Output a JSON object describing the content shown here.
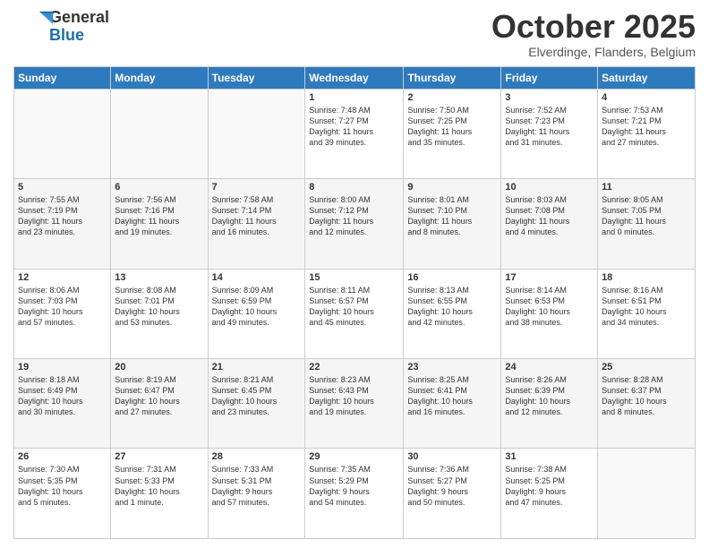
{
  "header": {
    "logo_general": "General",
    "logo_blue": "Blue",
    "month": "October 2025",
    "location": "Elverdinge, Flanders, Belgium"
  },
  "days_of_week": [
    "Sunday",
    "Monday",
    "Tuesday",
    "Wednesday",
    "Thursday",
    "Friday",
    "Saturday"
  ],
  "weeks": [
    [
      {
        "day": "",
        "info": ""
      },
      {
        "day": "",
        "info": ""
      },
      {
        "day": "",
        "info": ""
      },
      {
        "day": "1",
        "info": "Sunrise: 7:48 AM\nSunset: 7:27 PM\nDaylight: 11 hours\nand 39 minutes."
      },
      {
        "day": "2",
        "info": "Sunrise: 7:50 AM\nSunset: 7:25 PM\nDaylight: 11 hours\nand 35 minutes."
      },
      {
        "day": "3",
        "info": "Sunrise: 7:52 AM\nSunset: 7:23 PM\nDaylight: 11 hours\nand 31 minutes."
      },
      {
        "day": "4",
        "info": "Sunrise: 7:53 AM\nSunset: 7:21 PM\nDaylight: 11 hours\nand 27 minutes."
      }
    ],
    [
      {
        "day": "5",
        "info": "Sunrise: 7:55 AM\nSunset: 7:19 PM\nDaylight: 11 hours\nand 23 minutes."
      },
      {
        "day": "6",
        "info": "Sunrise: 7:56 AM\nSunset: 7:16 PM\nDaylight: 11 hours\nand 19 minutes."
      },
      {
        "day": "7",
        "info": "Sunrise: 7:58 AM\nSunset: 7:14 PM\nDaylight: 11 hours\nand 16 minutes."
      },
      {
        "day": "8",
        "info": "Sunrise: 8:00 AM\nSunset: 7:12 PM\nDaylight: 11 hours\nand 12 minutes."
      },
      {
        "day": "9",
        "info": "Sunrise: 8:01 AM\nSunset: 7:10 PM\nDaylight: 11 hours\nand 8 minutes."
      },
      {
        "day": "10",
        "info": "Sunrise: 8:03 AM\nSunset: 7:08 PM\nDaylight: 11 hours\nand 4 minutes."
      },
      {
        "day": "11",
        "info": "Sunrise: 8:05 AM\nSunset: 7:05 PM\nDaylight: 11 hours\nand 0 minutes."
      }
    ],
    [
      {
        "day": "12",
        "info": "Sunrise: 8:06 AM\nSunset: 7:03 PM\nDaylight: 10 hours\nand 57 minutes."
      },
      {
        "day": "13",
        "info": "Sunrise: 8:08 AM\nSunset: 7:01 PM\nDaylight: 10 hours\nand 53 minutes."
      },
      {
        "day": "14",
        "info": "Sunrise: 8:09 AM\nSunset: 6:59 PM\nDaylight: 10 hours\nand 49 minutes."
      },
      {
        "day": "15",
        "info": "Sunrise: 8:11 AM\nSunset: 6:57 PM\nDaylight: 10 hours\nand 45 minutes."
      },
      {
        "day": "16",
        "info": "Sunrise: 8:13 AM\nSunset: 6:55 PM\nDaylight: 10 hours\nand 42 minutes."
      },
      {
        "day": "17",
        "info": "Sunrise: 8:14 AM\nSunset: 6:53 PM\nDaylight: 10 hours\nand 38 minutes."
      },
      {
        "day": "18",
        "info": "Sunrise: 8:16 AM\nSunset: 6:51 PM\nDaylight: 10 hours\nand 34 minutes."
      }
    ],
    [
      {
        "day": "19",
        "info": "Sunrise: 8:18 AM\nSunset: 6:49 PM\nDaylight: 10 hours\nand 30 minutes."
      },
      {
        "day": "20",
        "info": "Sunrise: 8:19 AM\nSunset: 6:47 PM\nDaylight: 10 hours\nand 27 minutes."
      },
      {
        "day": "21",
        "info": "Sunrise: 8:21 AM\nSunset: 6:45 PM\nDaylight: 10 hours\nand 23 minutes."
      },
      {
        "day": "22",
        "info": "Sunrise: 8:23 AM\nSunset: 6:43 PM\nDaylight: 10 hours\nand 19 minutes."
      },
      {
        "day": "23",
        "info": "Sunrise: 8:25 AM\nSunset: 6:41 PM\nDaylight: 10 hours\nand 16 minutes."
      },
      {
        "day": "24",
        "info": "Sunrise: 8:26 AM\nSunset: 6:39 PM\nDaylight: 10 hours\nand 12 minutes."
      },
      {
        "day": "25",
        "info": "Sunrise: 8:28 AM\nSunset: 6:37 PM\nDaylight: 10 hours\nand 8 minutes."
      }
    ],
    [
      {
        "day": "26",
        "info": "Sunrise: 7:30 AM\nSunset: 5:35 PM\nDaylight: 10 hours\nand 5 minutes."
      },
      {
        "day": "27",
        "info": "Sunrise: 7:31 AM\nSunset: 5:33 PM\nDaylight: 10 hours\nand 1 minute."
      },
      {
        "day": "28",
        "info": "Sunrise: 7:33 AM\nSunset: 5:31 PM\nDaylight: 9 hours\nand 57 minutes."
      },
      {
        "day": "29",
        "info": "Sunrise: 7:35 AM\nSunset: 5:29 PM\nDaylight: 9 hours\nand 54 minutes."
      },
      {
        "day": "30",
        "info": "Sunrise: 7:36 AM\nSunset: 5:27 PM\nDaylight: 9 hours\nand 50 minutes."
      },
      {
        "day": "31",
        "info": "Sunrise: 7:38 AM\nSunset: 5:25 PM\nDaylight: 9 hours\nand 47 minutes."
      },
      {
        "day": "",
        "info": ""
      }
    ]
  ]
}
